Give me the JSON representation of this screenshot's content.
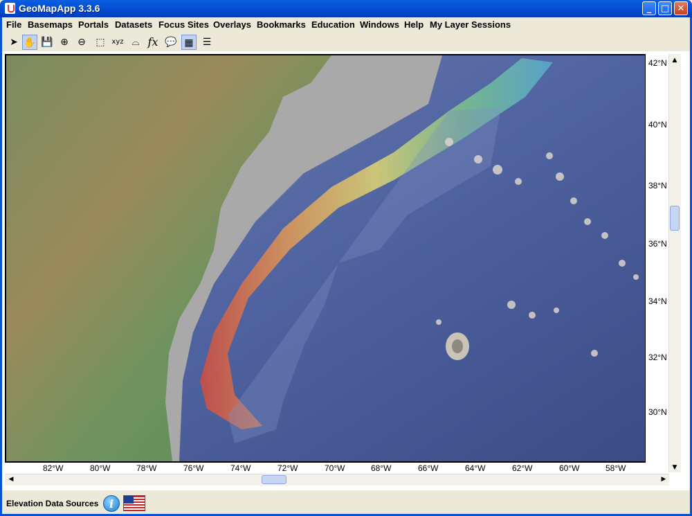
{
  "window": {
    "title": "GeoMapApp 3.3.6",
    "min_glyph": "_",
    "max_glyph": "□",
    "close_glyph": "✕"
  },
  "menu": [
    "File",
    "Basemaps",
    "Portals",
    "Datasets",
    "Focus Sites",
    "Overlays",
    "Bookmarks",
    "Education",
    "Windows",
    "Help",
    "My Layer Sessions"
  ],
  "toolbar": {
    "tools": [
      {
        "icon": "select-arrow-icon",
        "glyph": "➤"
      },
      {
        "icon": "pan-hand-icon",
        "glyph": "✋",
        "active": true
      },
      {
        "icon": "save-disk-icon",
        "glyph": "💾"
      },
      {
        "icon": "zoom-in-icon",
        "glyph": "⊕"
      },
      {
        "icon": "zoom-out-icon",
        "glyph": "⊖"
      },
      {
        "icon": "select-rect-icon",
        "glyph": "⬚"
      },
      {
        "icon": "xyz-profile-icon",
        "glyph": "xyz"
      },
      {
        "icon": "lasso-icon",
        "glyph": "⌓"
      },
      {
        "icon": "function-icon",
        "glyph": "fx"
      },
      {
        "icon": "speech-bubble-icon",
        "glyph": "💬"
      },
      {
        "icon": "grid-icon",
        "glyph": "▦",
        "active": true
      },
      {
        "icon": "list-icon",
        "glyph": "☰"
      }
    ]
  },
  "map": {
    "latitude_labels": [
      "42°N",
      "40°N",
      "38°N",
      "36°N",
      "34°N",
      "32°N",
      "30°N"
    ],
    "longitude_labels": [
      "82°W",
      "80°W",
      "78°W",
      "76°W",
      "74°W",
      "72°W",
      "70°W",
      "68°W",
      "66°W",
      "64°W",
      "62°W",
      "60°W",
      "58°W"
    ]
  },
  "scrollbars": {
    "up": "▲",
    "down": "▼",
    "left": "◀",
    "right": "▶"
  },
  "status": {
    "label": "Elevation Data Sources",
    "info_glyph": "i"
  }
}
